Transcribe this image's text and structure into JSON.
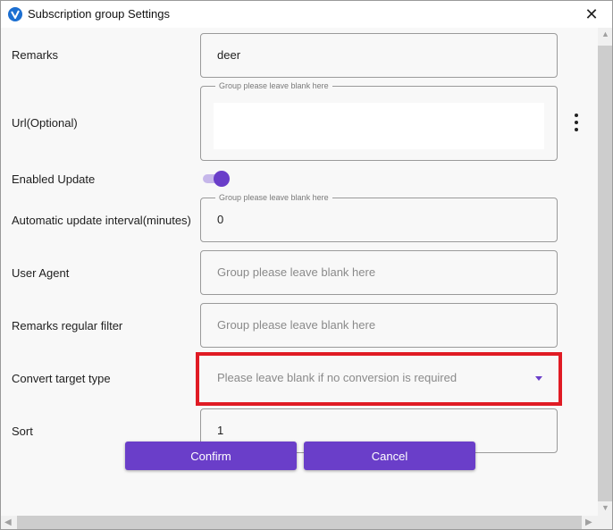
{
  "window": {
    "title": "Subscription group Settings",
    "close_glyph": "✕",
    "app_icon": "v2ray-logo-icon"
  },
  "form": {
    "remarks": {
      "label": "Remarks",
      "value": "deer"
    },
    "url": {
      "label": "Url(Optional)",
      "floating_label": "Group please leave blank here",
      "value": ""
    },
    "enabled_update": {
      "label": "Enabled Update",
      "on": true
    },
    "update_interval": {
      "label": "Automatic update interval(minutes)",
      "floating_label": "Group please leave blank here",
      "value": "0"
    },
    "user_agent": {
      "label": "User Agent",
      "placeholder": "Group please leave blank here"
    },
    "remarks_filter": {
      "label": "Remarks regular filter",
      "placeholder": "Group please leave blank here"
    },
    "convert_target": {
      "label": "Convert target type",
      "placeholder": "Please leave blank if no conversion is required"
    },
    "sort": {
      "label": "Sort",
      "value": "1"
    }
  },
  "buttons": {
    "confirm": "Confirm",
    "cancel": "Cancel"
  },
  "colors": {
    "accent": "#6a3ec9",
    "highlight": "#e01b24"
  }
}
